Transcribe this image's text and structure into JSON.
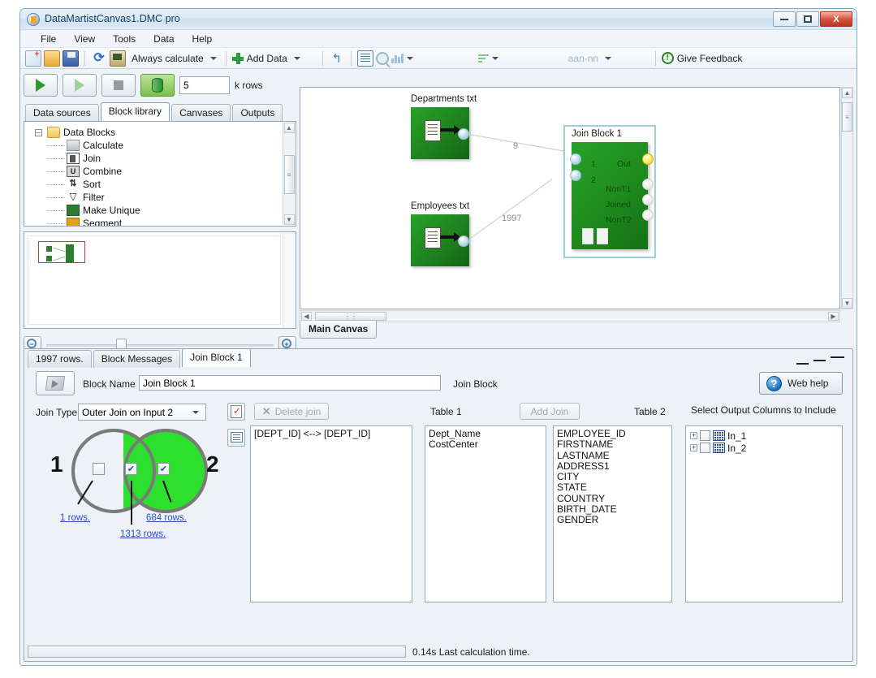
{
  "window": {
    "title": "DataMartistCanvas1.DMC pro",
    "minimize": "–",
    "maximize": "□",
    "close": "X"
  },
  "menu": [
    "File",
    "View",
    "Tools",
    "Data",
    "Help"
  ],
  "toolbar": {
    "calc_mode": "Always calculate",
    "add_data": "Add Data",
    "format_combo": "aan-nn",
    "feedback": "Give Feedback",
    "icons": [
      "new-file-icon",
      "open-folder-icon",
      "save-icon",
      "refresh-icon",
      "calculate-icon",
      "add-data-icon",
      "undo-icon",
      "grid-icon",
      "search-icon",
      "bar-chart-icon",
      "sort-icon",
      "feedback-icon"
    ]
  },
  "left_pane": {
    "run_controls": [
      "run-icon",
      "run-step-icon",
      "stop-icon",
      "sample-data-icon"
    ],
    "krows_value": "5",
    "krows_label": "k rows",
    "tabs": [
      "Data sources",
      "Block library",
      "Canvases",
      "Outputs"
    ],
    "active_tab": "Block library",
    "tree_root": "Data Blocks",
    "tree_items": [
      "Calculate",
      "Join",
      "Combine",
      "Sort",
      "Filter",
      "Make Unique",
      "Segment"
    ]
  },
  "canvas": {
    "tab": "Main Canvas",
    "nodes": [
      {
        "label": "Departments txt",
        "type": "source"
      },
      {
        "label": "Employees txt",
        "type": "source"
      },
      {
        "label": "Join Block 1",
        "type": "join"
      }
    ],
    "edges": [
      {
        "label": "9",
        "from": "Departments txt",
        "to": "1"
      },
      {
        "label": "1997",
        "from": "Employees txt",
        "to": "2"
      }
    ],
    "join_ports_in": [
      "1",
      "2"
    ],
    "join_ports_out": [
      "Out",
      "NonT1",
      "Joined",
      "NonT2"
    ]
  },
  "detail": {
    "tabs": [
      "1997 rows.",
      "Block Messages",
      "Join Block 1"
    ],
    "active_tab": "Join Block 1",
    "block_name_label": "Block Name",
    "block_name_value": "Join Block 1",
    "block_type": "Join Block",
    "web_help": "Web help",
    "join_type_label": "Join Type",
    "join_type_value": "Outer Join on Input 2",
    "venn": {
      "left_number": "1",
      "right_number": "2",
      "left_checked": false,
      "middle_checked": true,
      "right_checked": true,
      "left_rows": "1 rows.",
      "middle_rows": "1313 rows.",
      "right_rows": "684 rows.",
      "selected_fill": "#2ee02e"
    },
    "delete_join": "Delete join",
    "add_join": "Add Join",
    "join_conditions": [
      "[DEPT_ID] <--> [DEPT_ID]"
    ],
    "table1_header": "Table 1",
    "table1_columns": [
      "Dept_Name",
      "CostCenter"
    ],
    "table2_header": "Table 2",
    "table2_columns": [
      "EMPLOYEE_ID",
      "FIRSTNAME",
      "LASTNAME",
      "ADDRESS1",
      "CITY",
      "STATE",
      "COUNTRY",
      "BIRTH_DATE",
      "GENDER"
    ],
    "output_header": "Select Output Columns to Include",
    "output_items": [
      "In_1",
      "In_2"
    ]
  },
  "status": {
    "text": "0.14s Last calculation time.",
    "progress": 0
  }
}
